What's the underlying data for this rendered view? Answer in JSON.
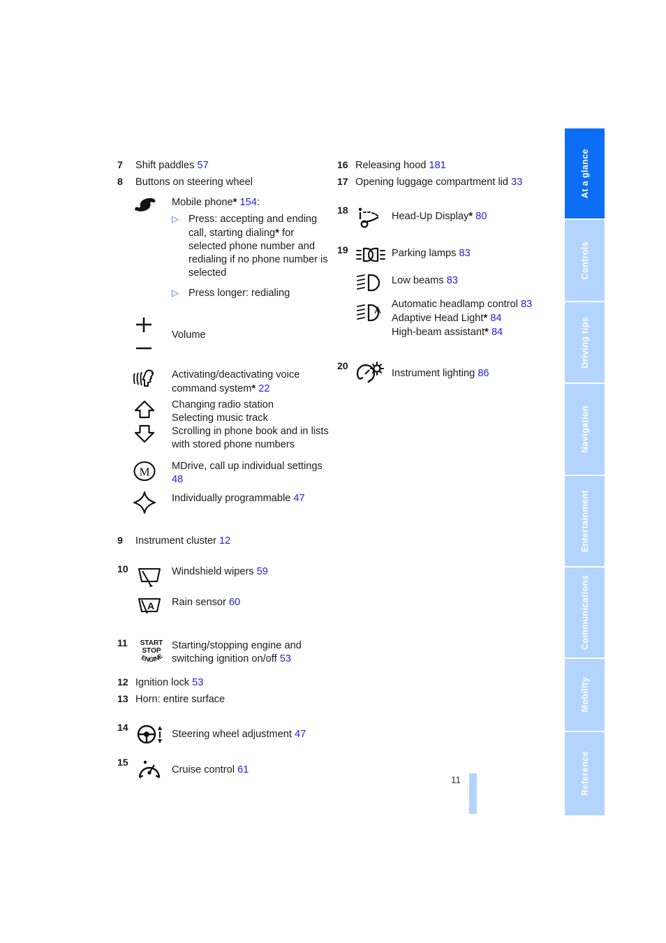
{
  "page": {
    "number": "11"
  },
  "tabs": [
    {
      "label": "At a glance",
      "active": true
    },
    {
      "label": "Controls",
      "active": false
    },
    {
      "label": "Driving tips",
      "active": false
    },
    {
      "label": "Navigation",
      "active": false
    },
    {
      "label": "Entertainment",
      "active": false
    },
    {
      "label": "Communications",
      "active": false
    },
    {
      "label": "Mobility",
      "active": false
    },
    {
      "label": "Reference",
      "active": false
    }
  ],
  "colors": {
    "reference_link": "#2222dd",
    "tab_active": "#0b6ef5",
    "tab_inactive": "#b3d4fc",
    "bullet": "#2f6ff0",
    "text": "#1b1b1b"
  },
  "left_column": {
    "item7": {
      "num": "7",
      "label": "Shift paddles",
      "ref": "57"
    },
    "item8": {
      "num": "8",
      "label": "Buttons on steering wheel",
      "phone": {
        "icon": "telephone-handset-icon",
        "label": "Mobile phone",
        "star": "*",
        "ref": "154",
        "colon": ":",
        "bullets": [
          "Press: accepting and ending call, starting dialing",
          "Press longer: redialing"
        ],
        "bullet1_star": "*",
        "bullet1_tail": " for selected phone number and redialing if no phone number is selected"
      },
      "volume": {
        "icon_plus": "plus-icon",
        "icon_minus": "minus-icon",
        "label": "Volume"
      },
      "voice": {
        "icon": "voice-command-icon",
        "label": "Activating/deactivating voice command system",
        "star": "*",
        "ref": "22"
      },
      "arrows": {
        "icon_up": "arrow-up-icon",
        "icon_down": "arrow-down-icon",
        "line1": "Changing radio station",
        "line2": "Selecting music track",
        "line3": "Scrolling in phone book and in lists with stored phone numbers"
      },
      "mdrive": {
        "icon": "mdrive-icon",
        "label": "MDrive, call up individual settings",
        "ref": "48"
      },
      "programmable": {
        "icon": "four-point-star-icon",
        "label": "Individually programmable",
        "ref": "47"
      }
    },
    "item9": {
      "num": "9",
      "label": "Instrument cluster",
      "ref": "12"
    },
    "item10": {
      "num": "10",
      "wipers": {
        "icon": "windshield-wiper-icon",
        "label": "Windshield wipers",
        "ref": "59"
      },
      "rain": {
        "icon": "rain-sensor-icon",
        "label": "Rain sensor",
        "ref": "60"
      }
    },
    "item11": {
      "num": "11",
      "icon": "start-stop-engine-icon",
      "icon_text": {
        "line1": "START",
        "line2": "STOP",
        "line3": "ENGINE"
      },
      "label": "Starting/stopping engine and switching ignition on/off",
      "ref": "53"
    },
    "item12": {
      "num": "12",
      "label": "Ignition lock",
      "ref": "53"
    },
    "item13": {
      "num": "13",
      "label": "Horn: entire surface"
    },
    "item14": {
      "num": "14",
      "icon": "steering-wheel-adjust-icon",
      "label": "Steering wheel adjustment",
      "ref": "47"
    },
    "item15": {
      "num": "15",
      "icon": "cruise-control-icon",
      "label": "Cruise control",
      "ref": "61"
    }
  },
  "right_column": {
    "item16": {
      "num": "16",
      "label": "Releasing hood",
      "ref": "181"
    },
    "item17": {
      "num": "17",
      "label": "Opening luggage compartment lid",
      "ref": "33"
    },
    "item18": {
      "num": "18",
      "icon": "head-up-display-icon",
      "label": "Head-Up Display",
      "star": "*",
      "ref": "80"
    },
    "item19": {
      "num": "19",
      "parking": {
        "icon": "parking-lamps-icon",
        "label": "Parking lamps",
        "ref": "83"
      },
      "low_beams": {
        "icon": "low-beam-icon",
        "label": "Low beams",
        "ref": "83"
      },
      "auto": {
        "icon": "adaptive-headlight-icon",
        "line1": "Automatic headlamp control",
        "ref1": "83",
        "line2": "Adaptive Head Light",
        "star2": "*",
        "ref2": "84",
        "line3": "High-beam assistant",
        "star3": "*",
        "ref3": "84"
      }
    },
    "item20": {
      "num": "20",
      "icon": "instrument-lighting-icon",
      "label": "Instrument lighting",
      "ref": "86"
    }
  }
}
